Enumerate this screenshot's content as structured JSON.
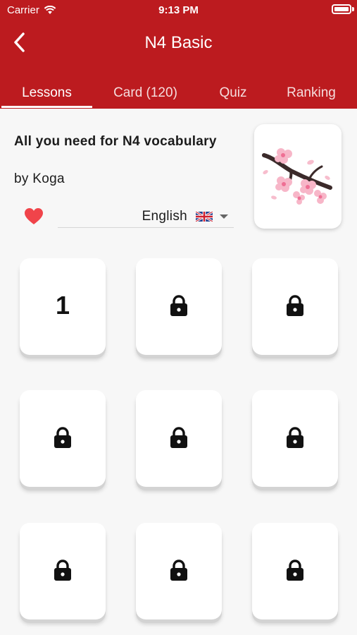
{
  "status_bar": {
    "carrier": "Carrier",
    "time": "9:13 PM"
  },
  "header": {
    "title": "N4 Basic",
    "back_icon": "chevron-left-icon"
  },
  "tabs": [
    {
      "label": "Lessons",
      "active": true
    },
    {
      "label": "Card (120)",
      "active": false
    },
    {
      "label": "Quiz",
      "active": false
    },
    {
      "label": "Ranking",
      "active": false
    }
  ],
  "course": {
    "title": "All you need for N4 vocabulary",
    "author": "by Koga",
    "language": "English",
    "favorite": true
  },
  "lessons": [
    {
      "label": "1",
      "locked": false
    },
    {
      "label": "",
      "locked": true
    },
    {
      "label": "",
      "locked": true
    },
    {
      "label": "",
      "locked": true
    },
    {
      "label": "",
      "locked": true
    },
    {
      "label": "",
      "locked": true
    },
    {
      "label": "",
      "locked": true
    },
    {
      "label": "",
      "locked": true
    },
    {
      "label": "",
      "locked": true
    }
  ],
  "colors": {
    "header": "#bc1b1f",
    "heart": "#f0444a",
    "background": "#f7f7f7"
  }
}
